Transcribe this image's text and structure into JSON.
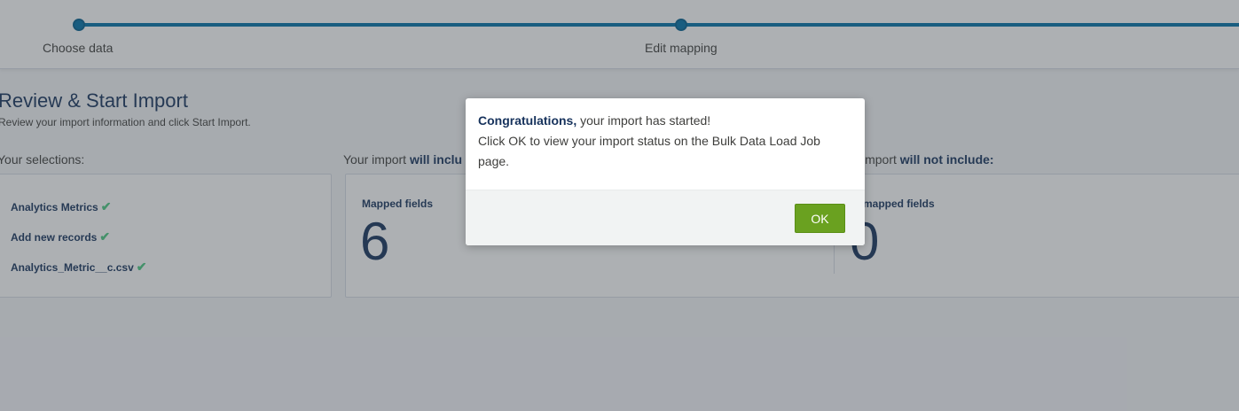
{
  "stepper": {
    "steps": [
      {
        "label": "Choose data"
      },
      {
        "label": "Edit mapping"
      }
    ]
  },
  "review": {
    "title": "Review & Start Import",
    "subtitle": "Review your import information and click Start Import."
  },
  "selections": {
    "heading": "Your selections:",
    "items": [
      {
        "label": "Analytics Metrics"
      },
      {
        "label": "Add new records"
      },
      {
        "label": "Analytics_Metric__c.csv"
      }
    ],
    "check_icon": "checkmark-icon",
    "check_color": "#4bca81"
  },
  "will_include": {
    "heading_prefix": "Your import ",
    "heading_bold": "will inclu",
    "mapped_label": "Mapped fields",
    "mapped_value": "6"
  },
  "will_not_include": {
    "heading_prefix": "import ",
    "heading_bold": "will not include:",
    "unmapped_label": "mapped fields",
    "unmapped_value": "0"
  },
  "modal": {
    "title_bold": "Congratulations,",
    "title_rest": " your import has started!",
    "message": "Click OK to view your import status on the Bulk Data Load Job page.",
    "ok_label": "OK",
    "ok_color": "#6aa120"
  },
  "colors": {
    "accent": "#0070a8",
    "overlay": "rgba(60,66,75,0.42)"
  }
}
